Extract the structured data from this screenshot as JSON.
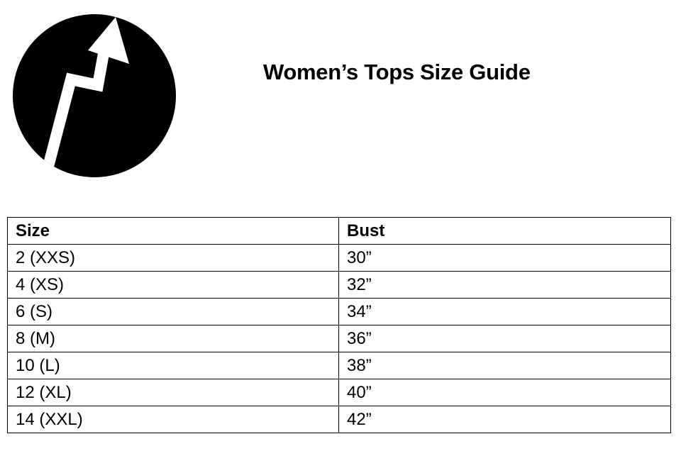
{
  "title": "Women’s Tops Size Guide",
  "logo": {
    "icon": "upward-arrow-circle-logo"
  },
  "table": {
    "headers": [
      "Size",
      "Bust"
    ],
    "rows": [
      [
        "2 (XXS)",
        "30”"
      ],
      [
        "4 (XS)",
        "32”"
      ],
      [
        "6 (S)",
        "34”"
      ],
      [
        "8 (M)",
        "36”"
      ],
      [
        "10 (L)",
        "38”"
      ],
      [
        "12 (XL)",
        "40”"
      ],
      [
        "14 (XXL)",
        "42”"
      ]
    ]
  }
}
